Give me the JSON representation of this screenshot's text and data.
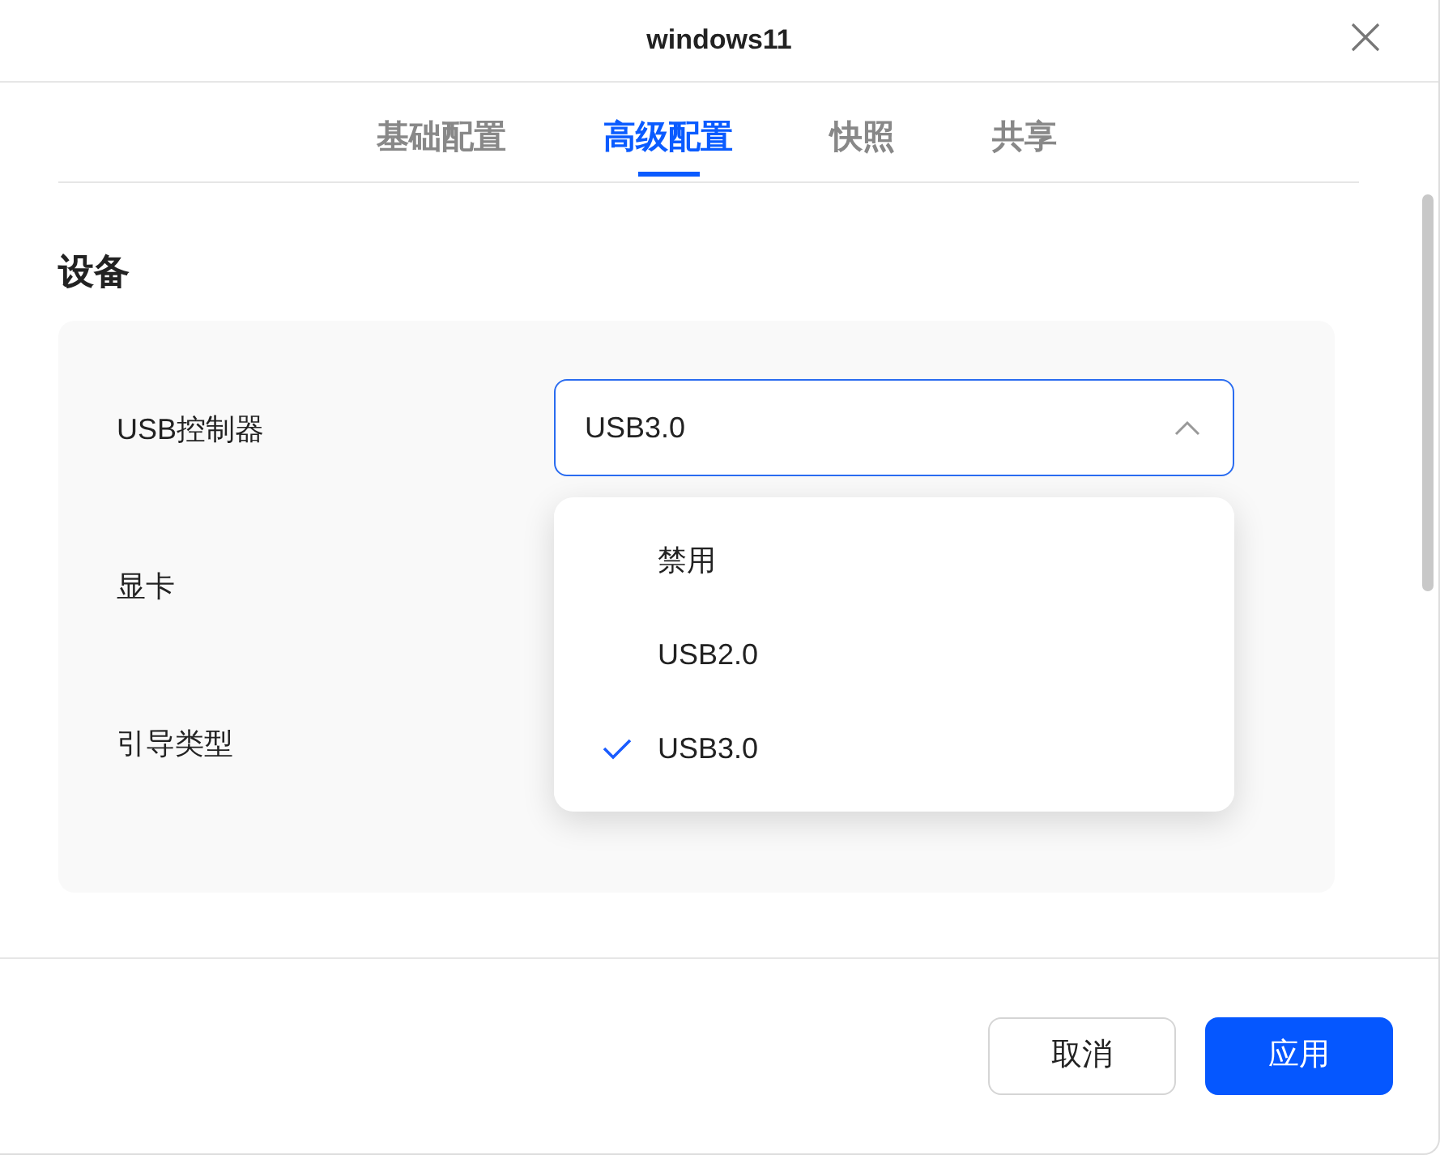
{
  "window": {
    "title": "windows11"
  },
  "tabs": [
    {
      "label": "基础配置",
      "selected": false
    },
    {
      "label": "高级配置",
      "selected": true
    },
    {
      "label": "快照",
      "selected": false
    },
    {
      "label": "共享",
      "selected": false
    }
  ],
  "section": {
    "title": "设备",
    "fields": [
      {
        "label": "USB控制器",
        "value": "USB3.0",
        "expanded": true,
        "options": [
          {
            "label": "禁用",
            "selected": false
          },
          {
            "label": "USB2.0",
            "selected": false
          },
          {
            "label": "USB3.0",
            "selected": true
          }
        ]
      },
      {
        "label": "显卡"
      },
      {
        "label": "引导类型"
      }
    ]
  },
  "buttons": [
    {
      "label": "取消",
      "kind": "secondary"
    },
    {
      "label": "应用",
      "kind": "primary"
    }
  ]
}
